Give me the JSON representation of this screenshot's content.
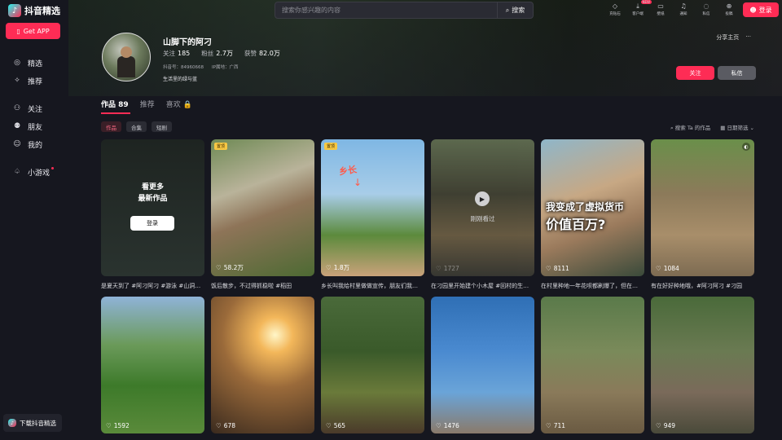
{
  "app": {
    "logo_text": "抖音精选",
    "get_app": "Get APP",
    "download": "下载抖音精选"
  },
  "sidebar": {
    "items": [
      {
        "label": "精选"
      },
      {
        "label": "推荐"
      },
      {
        "label": "关注"
      },
      {
        "label": "朋友"
      },
      {
        "label": "我的"
      },
      {
        "label": "小游戏"
      }
    ]
  },
  "search": {
    "placeholder": "搜索你感兴趣的内容",
    "button": "搜索"
  },
  "topbar": {
    "icons": [
      {
        "label": "充钻石"
      },
      {
        "label": "客户端",
        "badge": "NEW"
      },
      {
        "label": "壁纸"
      },
      {
        "label": "通知"
      },
      {
        "label": "私信"
      },
      {
        "label": "投稿"
      }
    ],
    "login": "登录"
  },
  "profile": {
    "name": "山脚下的阿刁",
    "stats": [
      {
        "label": "关注",
        "value": "185"
      },
      {
        "label": "粉丝",
        "value": "2.7万"
      },
      {
        "label": "获赞",
        "value": "82.0万"
      }
    ],
    "douyin_id": "抖音号：84960668",
    "ip": "IP属地：广西",
    "bio": "生活里的绿与蓝",
    "share": "分享主页",
    "more": "···",
    "follow": "关注",
    "message": "私信"
  },
  "tabs": [
    {
      "label": "作品 89"
    },
    {
      "label": "推荐"
    },
    {
      "label": "喜欢 🔒"
    }
  ],
  "chips": [
    "作品",
    "合集",
    "短剧"
  ],
  "filters": {
    "search_works": "搜索 Ta 的作品",
    "date_filter": "日期筛选"
  },
  "grid": {
    "more_card": {
      "line1": "看更多",
      "line2": "最新作品",
      "login": "登录"
    },
    "cards": [
      {
        "caption": "是夏天到了 #阿刁阿刁 #游泳 #山洞…",
        "likes": "",
        "badge": ""
      },
      {
        "caption": "饭后散步，不过得抓稳啦 #稻田",
        "likes": "58.2万",
        "badge": "置顶"
      },
      {
        "caption": "乡长叫我给村里做做宣传，朋友们我…",
        "likes": "1.8万",
        "badge": "置顶",
        "hand_text": "乡长"
      },
      {
        "caption": "在刁园里开始建个小木屋 #回村的生…",
        "likes": "1727",
        "badge": "",
        "watched": "刚刚看过"
      },
      {
        "caption": "在村里种地一年花呗都刷爆了，但在…",
        "likes": "8111",
        "badge": "",
        "overlay1": "我变成了虚拟货币",
        "overlay2": "价值百万?"
      },
      {
        "caption": "有在好好种地哦，#阿刁阿刁 #刁园",
        "likes": "1084",
        "badge": ""
      },
      {
        "caption": "",
        "likes": "1592"
      },
      {
        "caption": "",
        "likes": "678"
      },
      {
        "caption": "",
        "likes": "565"
      },
      {
        "caption": "",
        "likes": "1476"
      },
      {
        "caption": "",
        "likes": "711"
      },
      {
        "caption": "",
        "likes": "949"
      }
    ]
  },
  "colors": {
    "accent": "#fe2c55",
    "background": "#16171f",
    "badge": "#f6c744"
  }
}
